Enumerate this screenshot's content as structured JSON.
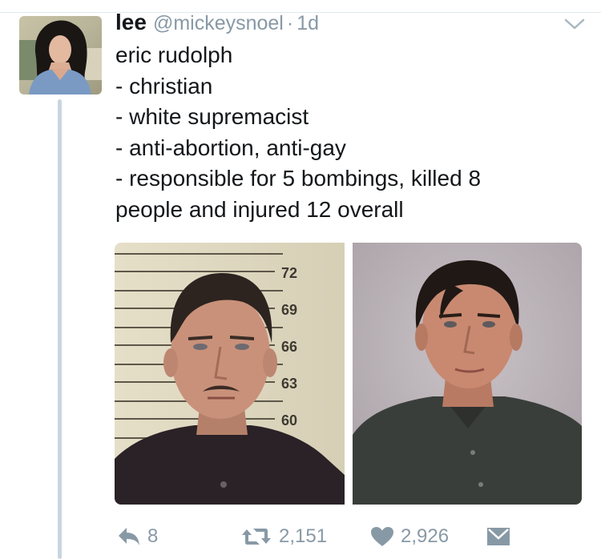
{
  "tweet": {
    "display_name": "lee",
    "handle": "@mickeysnoel",
    "separator": "·",
    "time": "1d",
    "text_lines": [
      "eric rudolph",
      "- christian",
      "- white supremacist",
      "- anti-abortion, anti-gay",
      "- responsible for 5 bombings, killed 8",
      "people and injured 12 overall"
    ],
    "mugshot_height_labels": [
      "72",
      "69",
      "66",
      "63",
      "60"
    ]
  },
  "actions": {
    "reply_count": "8",
    "retweet_count": "2,151",
    "like_count": "2,926"
  },
  "colors": {
    "text": "#14171a",
    "muted": "#8899a6",
    "thread_line": "#c9d6df",
    "border": "#e1e8ed"
  },
  "icons": [
    "reply-icon",
    "retweet-icon",
    "heart-icon",
    "direct-message-icon",
    "chevron-down-icon"
  ]
}
